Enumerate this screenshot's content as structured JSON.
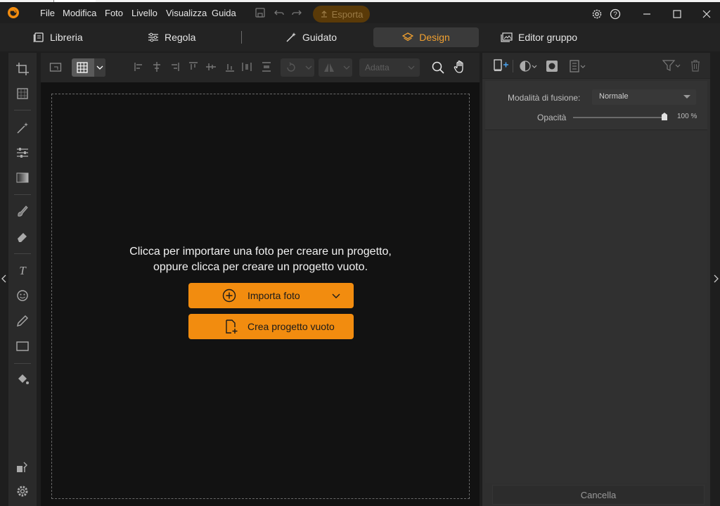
{
  "menu": [
    "File",
    "Modifica",
    "Foto",
    "Livello",
    "Visualizza",
    "Guida"
  ],
  "toolbar": {
    "export_label": "Esporta"
  },
  "modes": [
    {
      "label": "Libreria",
      "icon": "library-icon"
    },
    {
      "label": "Regola",
      "icon": "sliders-icon"
    },
    {
      "label": "Guidato",
      "icon": "magic-wand-icon"
    },
    {
      "label": "Design",
      "icon": "layers-icon",
      "active": true
    },
    {
      "label": "Editor gruppo",
      "icon": "image-group-icon"
    }
  ],
  "canvas_toolbar": {
    "fit_select": "Adatta"
  },
  "canvas": {
    "prompt_line1": "Clicca per importare una foto per creare un progetto,",
    "prompt_line2": "oppure clicca per creare un progetto vuoto.",
    "import_label": "Importa foto",
    "new_project_label": "Crea progetto vuoto"
  },
  "right_panel": {
    "blend_label": "Modalità di fusione:",
    "blend_value": "Normale",
    "opacity_label": "Opacità",
    "opacity_value": "100 %",
    "opacity_level": 1.0,
    "cancel_label": "Cancella"
  },
  "colors": {
    "accent": "#f28c0f",
    "active_tab_text": "#f0a030",
    "canvas_bg": "#121212"
  }
}
